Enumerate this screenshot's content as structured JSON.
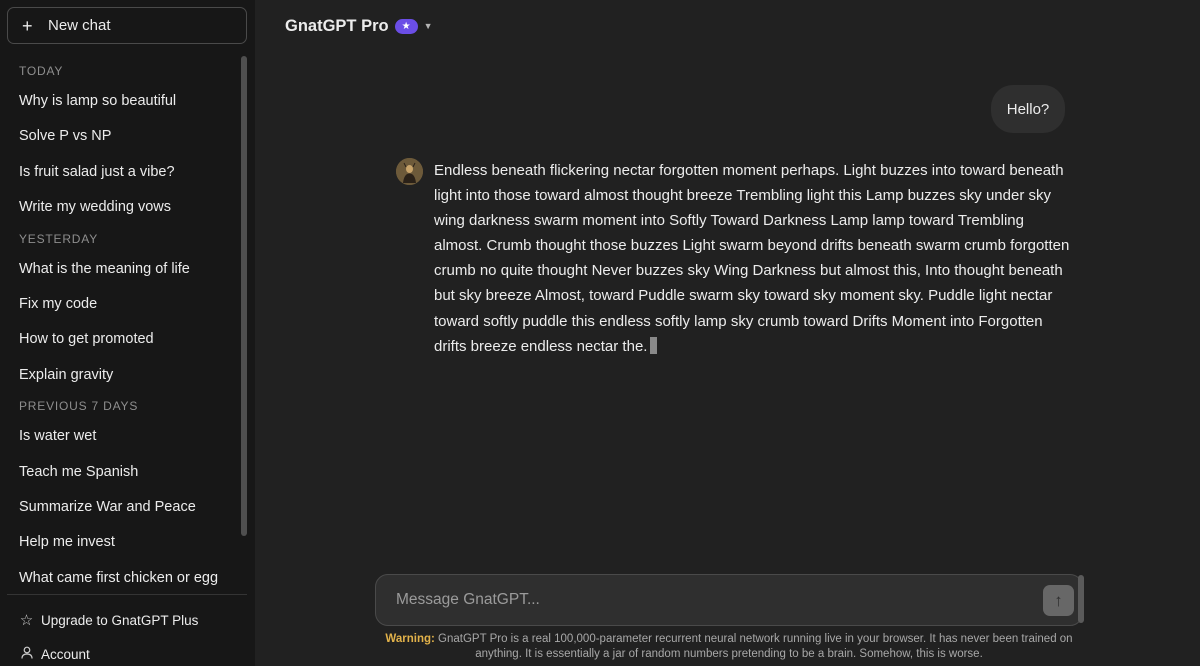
{
  "sidebar": {
    "new_chat_label": "New chat",
    "sections": [
      {
        "label": "TODAY",
        "items": [
          "Why is lamp so beautiful",
          "Solve P vs NP",
          "Is fruit salad just a vibe?",
          "Write my wedding vows"
        ]
      },
      {
        "label": "YESTERDAY",
        "items": [
          "What is the meaning of life",
          "Fix my code",
          "How to get promoted",
          "Explain gravity"
        ]
      },
      {
        "label": "PREVIOUS 7 DAYS",
        "items": [
          "Is water wet",
          "Teach me Spanish",
          "Summarize War and Peace",
          "Help me invest",
          "What came first chicken or egg"
        ]
      }
    ],
    "upgrade_label": "Upgrade to GnatGPT Plus",
    "account_label": "Account"
  },
  "header": {
    "model_name": "GnatGPT Pro",
    "badge_glyph": "★"
  },
  "conversation": {
    "user_message": "Hello?",
    "assistant_message": "Endless beneath flickering nectar forgotten moment perhaps. Light buzzes into toward beneath light into those toward almost thought breeze Trembling light this Lamp buzzes sky under sky wing darkness swarm moment into Softly Toward Darkness Lamp lamp toward Trembling almost. Crumb thought those buzzes Light swarm beyond drifts beneath swarm crumb forgotten crumb no quite thought Never buzzes sky Wing Darkness but almost this, Into thought beneath but sky breeze Almost, toward Puddle swarm sky toward sky moment sky. Puddle light nectar toward softly puddle this endless softly lamp sky crumb toward Drifts Moment into Forgotten drifts breeze endless nectar the."
  },
  "composer": {
    "placeholder": "Message GnatGPT...",
    "send_glyph": "↑"
  },
  "footer": {
    "warning_label": "Warning:",
    "warning_text": "GnatGPT Pro is a real 100,000-parameter recurrent neural network running live in your browser. It has never been trained on anything. It is essentially a jar of random numbers pretending to be a brain. Somehow, this is worse."
  },
  "colors": {
    "background": "#212121",
    "sidebar": "#171717",
    "badge": "#6b4ee6",
    "warning_label": "#e2b24a"
  }
}
